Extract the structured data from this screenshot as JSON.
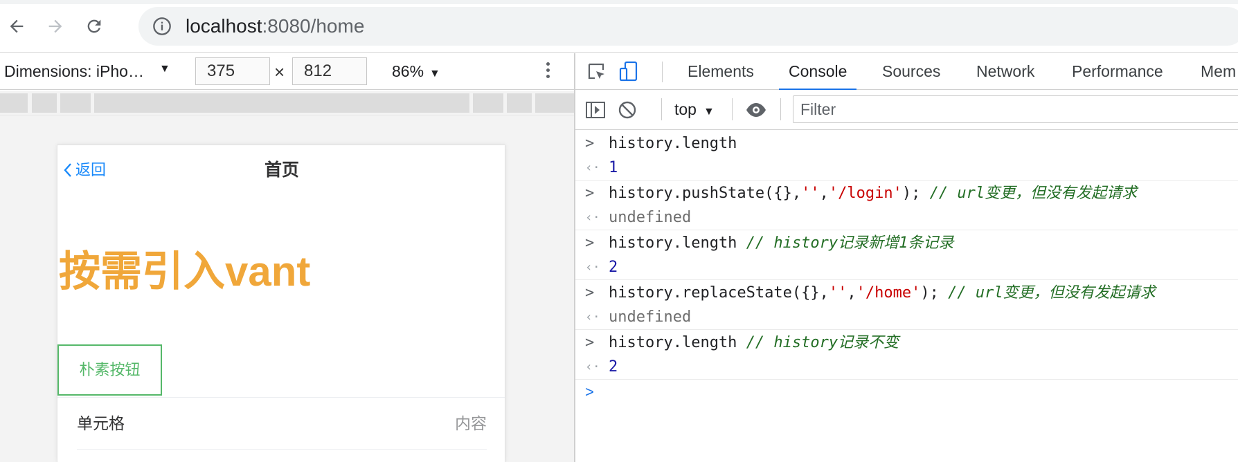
{
  "browser": {
    "url_host": "localhost",
    "url_rest": ":8080/home"
  },
  "device_toolbar": {
    "dimensions_label": "Dimensions: iPho…",
    "width": "375",
    "height": "812",
    "times": "×",
    "zoom": "86%"
  },
  "page": {
    "back_label": "返回",
    "nav_title": "首页",
    "heading": "按需引入vant",
    "button_label": "朴素按钮",
    "cell_title": "单元格",
    "cell_value": "内容"
  },
  "devtools": {
    "tabs": [
      "Elements",
      "Console",
      "Sources",
      "Network",
      "Performance",
      "Mem"
    ],
    "active_tab": "Console",
    "context": "top",
    "filter_placeholder": "Filter",
    "entries": [
      {
        "input": [
          {
            "t": "code",
            "v": "history.length"
          }
        ],
        "output": {
          "t": "num",
          "v": "1"
        }
      },
      {
        "input": [
          {
            "t": "code",
            "v": "history.pushState({},"
          },
          {
            "t": "str",
            "v": "''"
          },
          {
            "t": "code",
            "v": ","
          },
          {
            "t": "str",
            "v": "'/login'"
          },
          {
            "t": "code",
            "v": "); "
          },
          {
            "t": "cmt",
            "v": "// url变更，但没有发起请求"
          }
        ],
        "output": {
          "t": "undef",
          "v": "undefined"
        }
      },
      {
        "input": [
          {
            "t": "code",
            "v": "history.length "
          },
          {
            "t": "cmt",
            "v": "// history记录新增1条记录"
          }
        ],
        "output": {
          "t": "num",
          "v": "2"
        }
      },
      {
        "input": [
          {
            "t": "code",
            "v": "history.replaceState({},"
          },
          {
            "t": "str",
            "v": "''"
          },
          {
            "t": "code",
            "v": ","
          },
          {
            "t": "str",
            "v": "'/home'"
          },
          {
            "t": "code",
            "v": "); "
          },
          {
            "t": "cmt",
            "v": "// url变更，但没有发起请求"
          }
        ],
        "output": {
          "t": "undef",
          "v": "undefined"
        }
      },
      {
        "input": [
          {
            "t": "code",
            "v": "history.length "
          },
          {
            "t": "cmt",
            "v": "// history记录不变"
          }
        ],
        "output": {
          "t": "num",
          "v": "2"
        }
      }
    ]
  },
  "colors": {
    "accent": "#1a73e8",
    "heading": "#f0a73a",
    "plain_button": "#55b869",
    "link": "#1989fa"
  },
  "icons": [
    "back-arrow-icon",
    "forward-arrow-icon",
    "reload-icon",
    "info-icon",
    "inspect-icon",
    "device-toggle-icon",
    "sidebar-icon",
    "clear-icon",
    "eye-icon",
    "chevron-left-icon",
    "caret-down-icon",
    "kebab-icon"
  ]
}
